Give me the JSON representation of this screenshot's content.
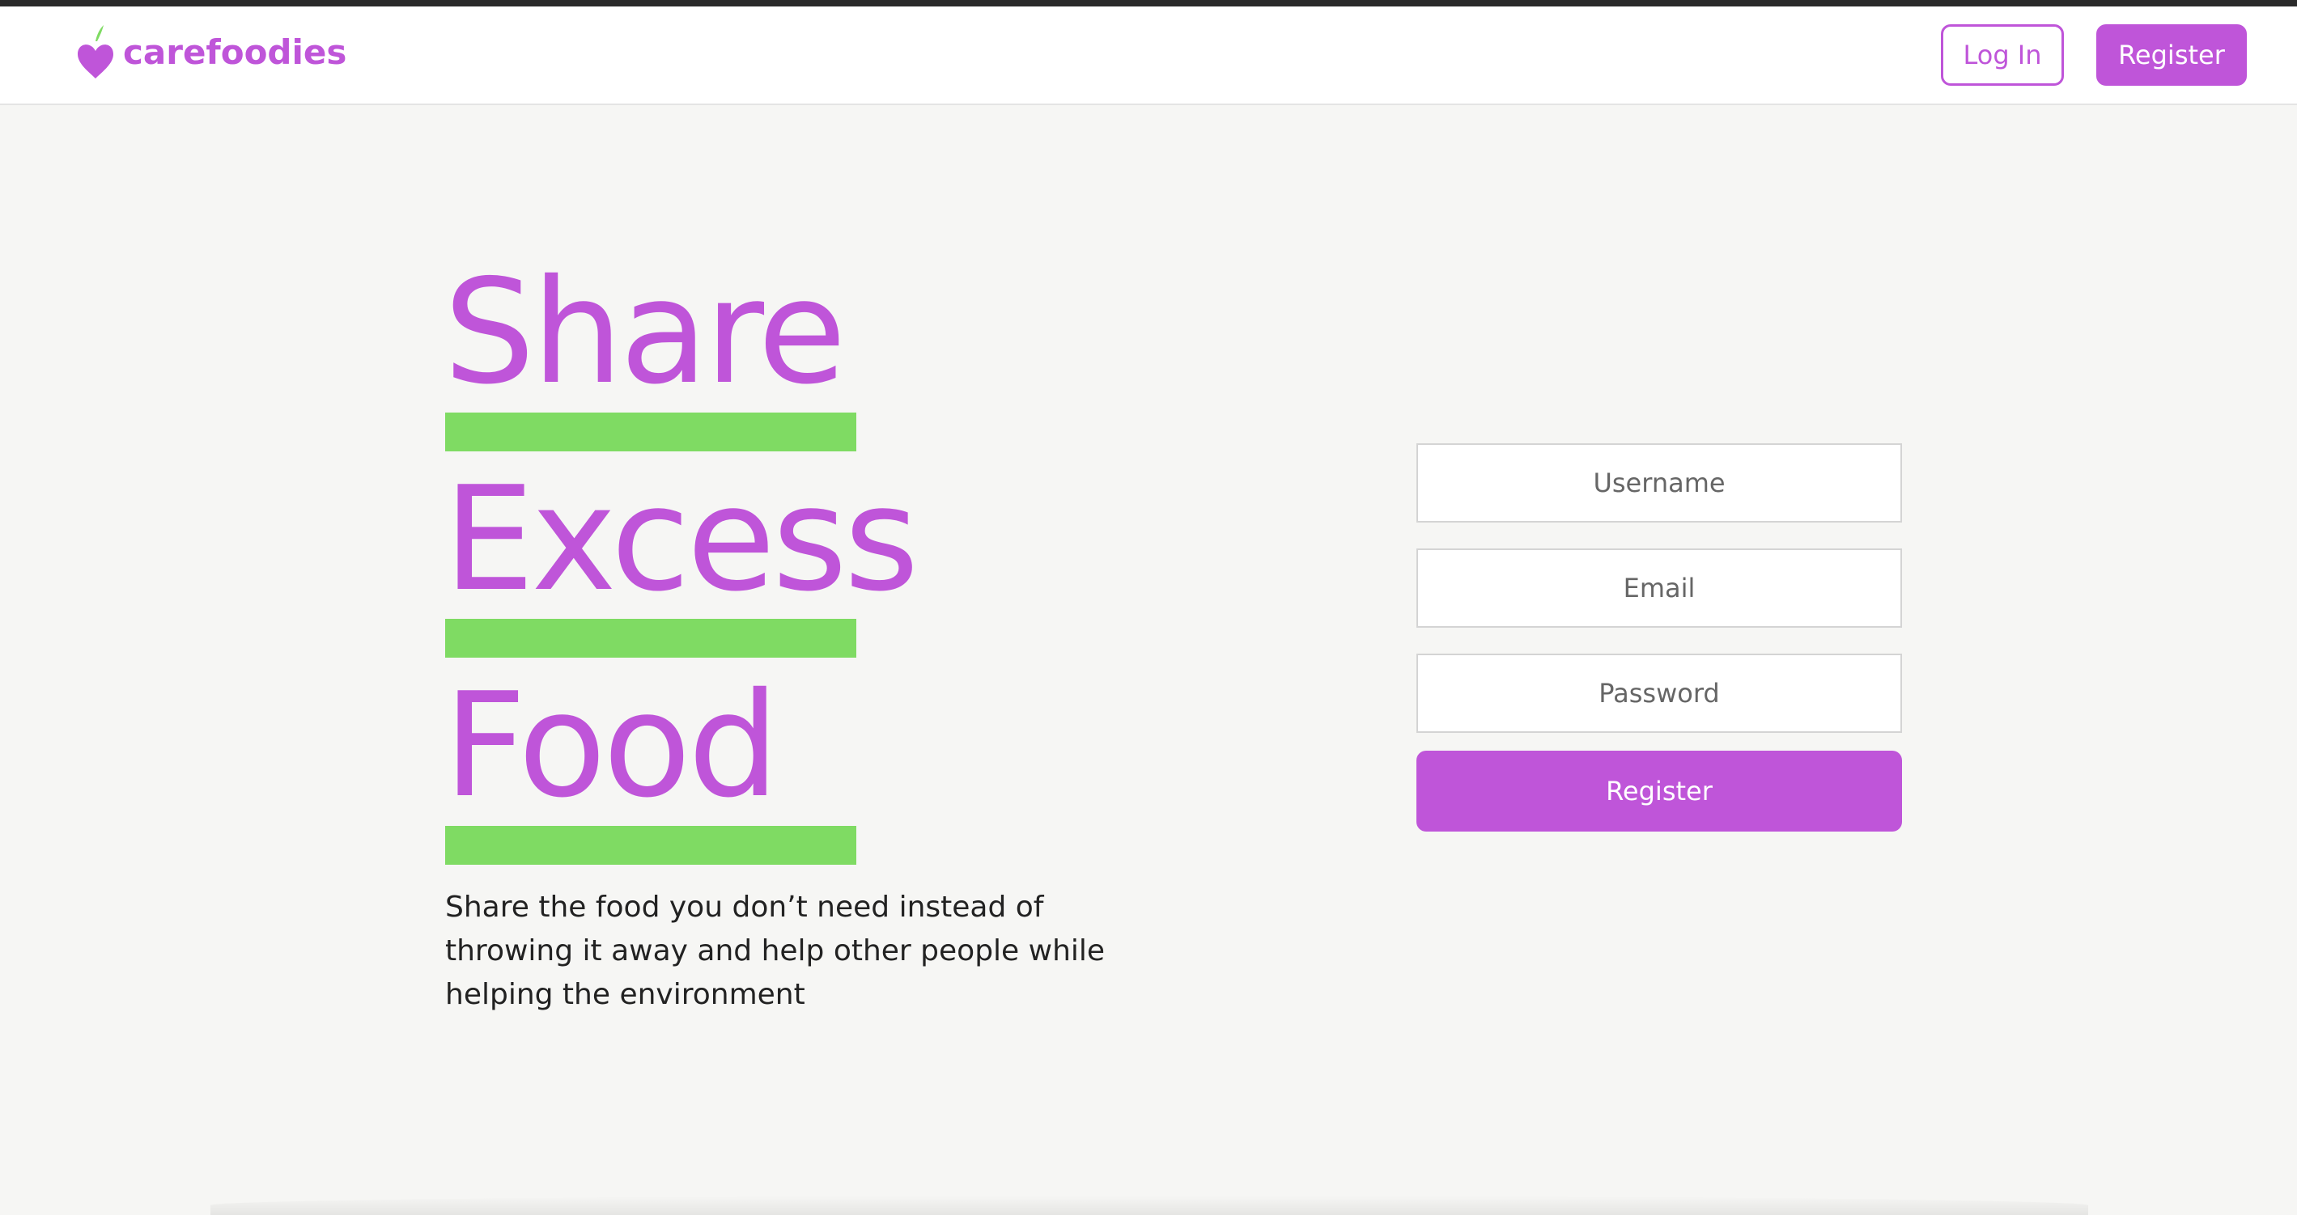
{
  "brand": {
    "name": "carefoodies",
    "accent_color": "#bf55d9",
    "leaf_color": "#7fdb63",
    "logo_icon": "heart-apple-icon"
  },
  "nav": {
    "login_label": "Log In",
    "register_label": "Register"
  },
  "hero": {
    "words": [
      "Share",
      "Excess",
      "Food"
    ],
    "tagline": "Share the food you don’t need instead of throwing it away and help other people while helping the environment"
  },
  "register_form": {
    "username_placeholder": "Username",
    "email_placeholder": "Email",
    "password_placeholder": "Password",
    "submit_label": "Register"
  }
}
